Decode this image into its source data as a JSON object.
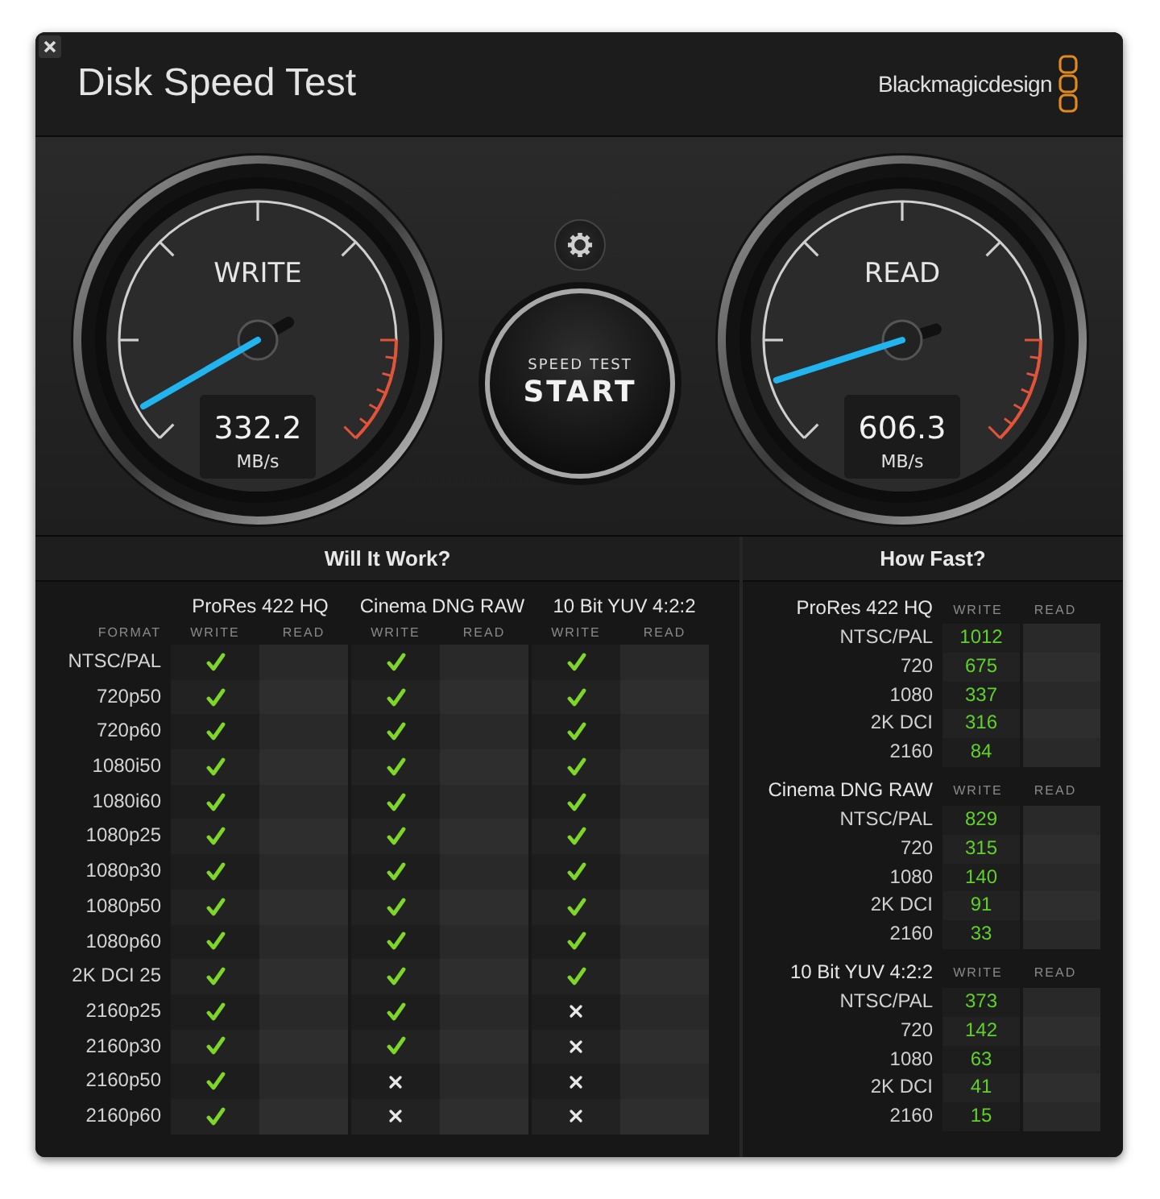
{
  "window": {
    "title": "Disk Speed Test",
    "brand": "Blackmagicdesign"
  },
  "gauges": [
    {
      "label": "WRITE",
      "value": "332.2",
      "unit": "MB/s"
    },
    {
      "label": "READ",
      "value": "606.3",
      "unit": "MB/s"
    }
  ],
  "start_button": {
    "caption": "SPEED TEST",
    "label": "START"
  },
  "will_it_work": {
    "title": "Will It Work?",
    "format_heading": "FORMAT",
    "codecs": [
      {
        "name": "ProRes 422 HQ",
        "write_heading": "WRITE",
        "read_heading": "READ"
      },
      {
        "name": "Cinema DNG RAW",
        "write_heading": "WRITE",
        "read_heading": "READ"
      },
      {
        "name": "10 Bit YUV 4:2:2",
        "write_heading": "WRITE",
        "read_heading": "READ"
      }
    ],
    "rows": [
      {
        "format": "NTSC/PAL",
        "write": [
          true,
          true,
          true
        ]
      },
      {
        "format": "720p50",
        "write": [
          true,
          true,
          true
        ]
      },
      {
        "format": "720p60",
        "write": [
          true,
          true,
          true
        ]
      },
      {
        "format": "1080i50",
        "write": [
          true,
          true,
          true
        ]
      },
      {
        "format": "1080i60",
        "write": [
          true,
          true,
          true
        ]
      },
      {
        "format": "1080p25",
        "write": [
          true,
          true,
          true
        ]
      },
      {
        "format": "1080p30",
        "write": [
          true,
          true,
          true
        ]
      },
      {
        "format": "1080p50",
        "write": [
          true,
          true,
          true
        ]
      },
      {
        "format": "1080p60",
        "write": [
          true,
          true,
          true
        ]
      },
      {
        "format": "2K DCI 25",
        "write": [
          true,
          true,
          true
        ]
      },
      {
        "format": "2160p25",
        "write": [
          true,
          true,
          false
        ]
      },
      {
        "format": "2160p30",
        "write": [
          true,
          true,
          false
        ]
      },
      {
        "format": "2160p50",
        "write": [
          true,
          false,
          false
        ]
      },
      {
        "format": "2160p60",
        "write": [
          true,
          false,
          false
        ]
      }
    ]
  },
  "how_fast": {
    "title": "How Fast?",
    "groups": [
      {
        "codec": "ProRes 422 HQ",
        "write_heading": "WRITE",
        "read_heading": "READ",
        "rows": [
          {
            "format": "NTSC/PAL",
            "write": "1012"
          },
          {
            "format": "720",
            "write": "675"
          },
          {
            "format": "1080",
            "write": "337"
          },
          {
            "format": "2K DCI",
            "write": "316"
          },
          {
            "format": "2160",
            "write": "84"
          }
        ]
      },
      {
        "codec": "Cinema DNG RAW",
        "write_heading": "WRITE",
        "read_heading": "READ",
        "rows": [
          {
            "format": "NTSC/PAL",
            "write": "829"
          },
          {
            "format": "720",
            "write": "315"
          },
          {
            "format": "1080",
            "write": "140"
          },
          {
            "format": "2K DCI",
            "write": "91"
          },
          {
            "format": "2160",
            "write": "33"
          }
        ]
      },
      {
        "codec": "10 Bit YUV 4:2:2",
        "write_heading": "WRITE",
        "read_heading": "READ",
        "rows": [
          {
            "format": "NTSC/PAL",
            "write": "373"
          },
          {
            "format": "720",
            "write": "142"
          },
          {
            "format": "1080",
            "write": "63"
          },
          {
            "format": "2K DCI",
            "write": "41"
          },
          {
            "format": "2160",
            "write": "15"
          }
        ]
      }
    ]
  }
}
